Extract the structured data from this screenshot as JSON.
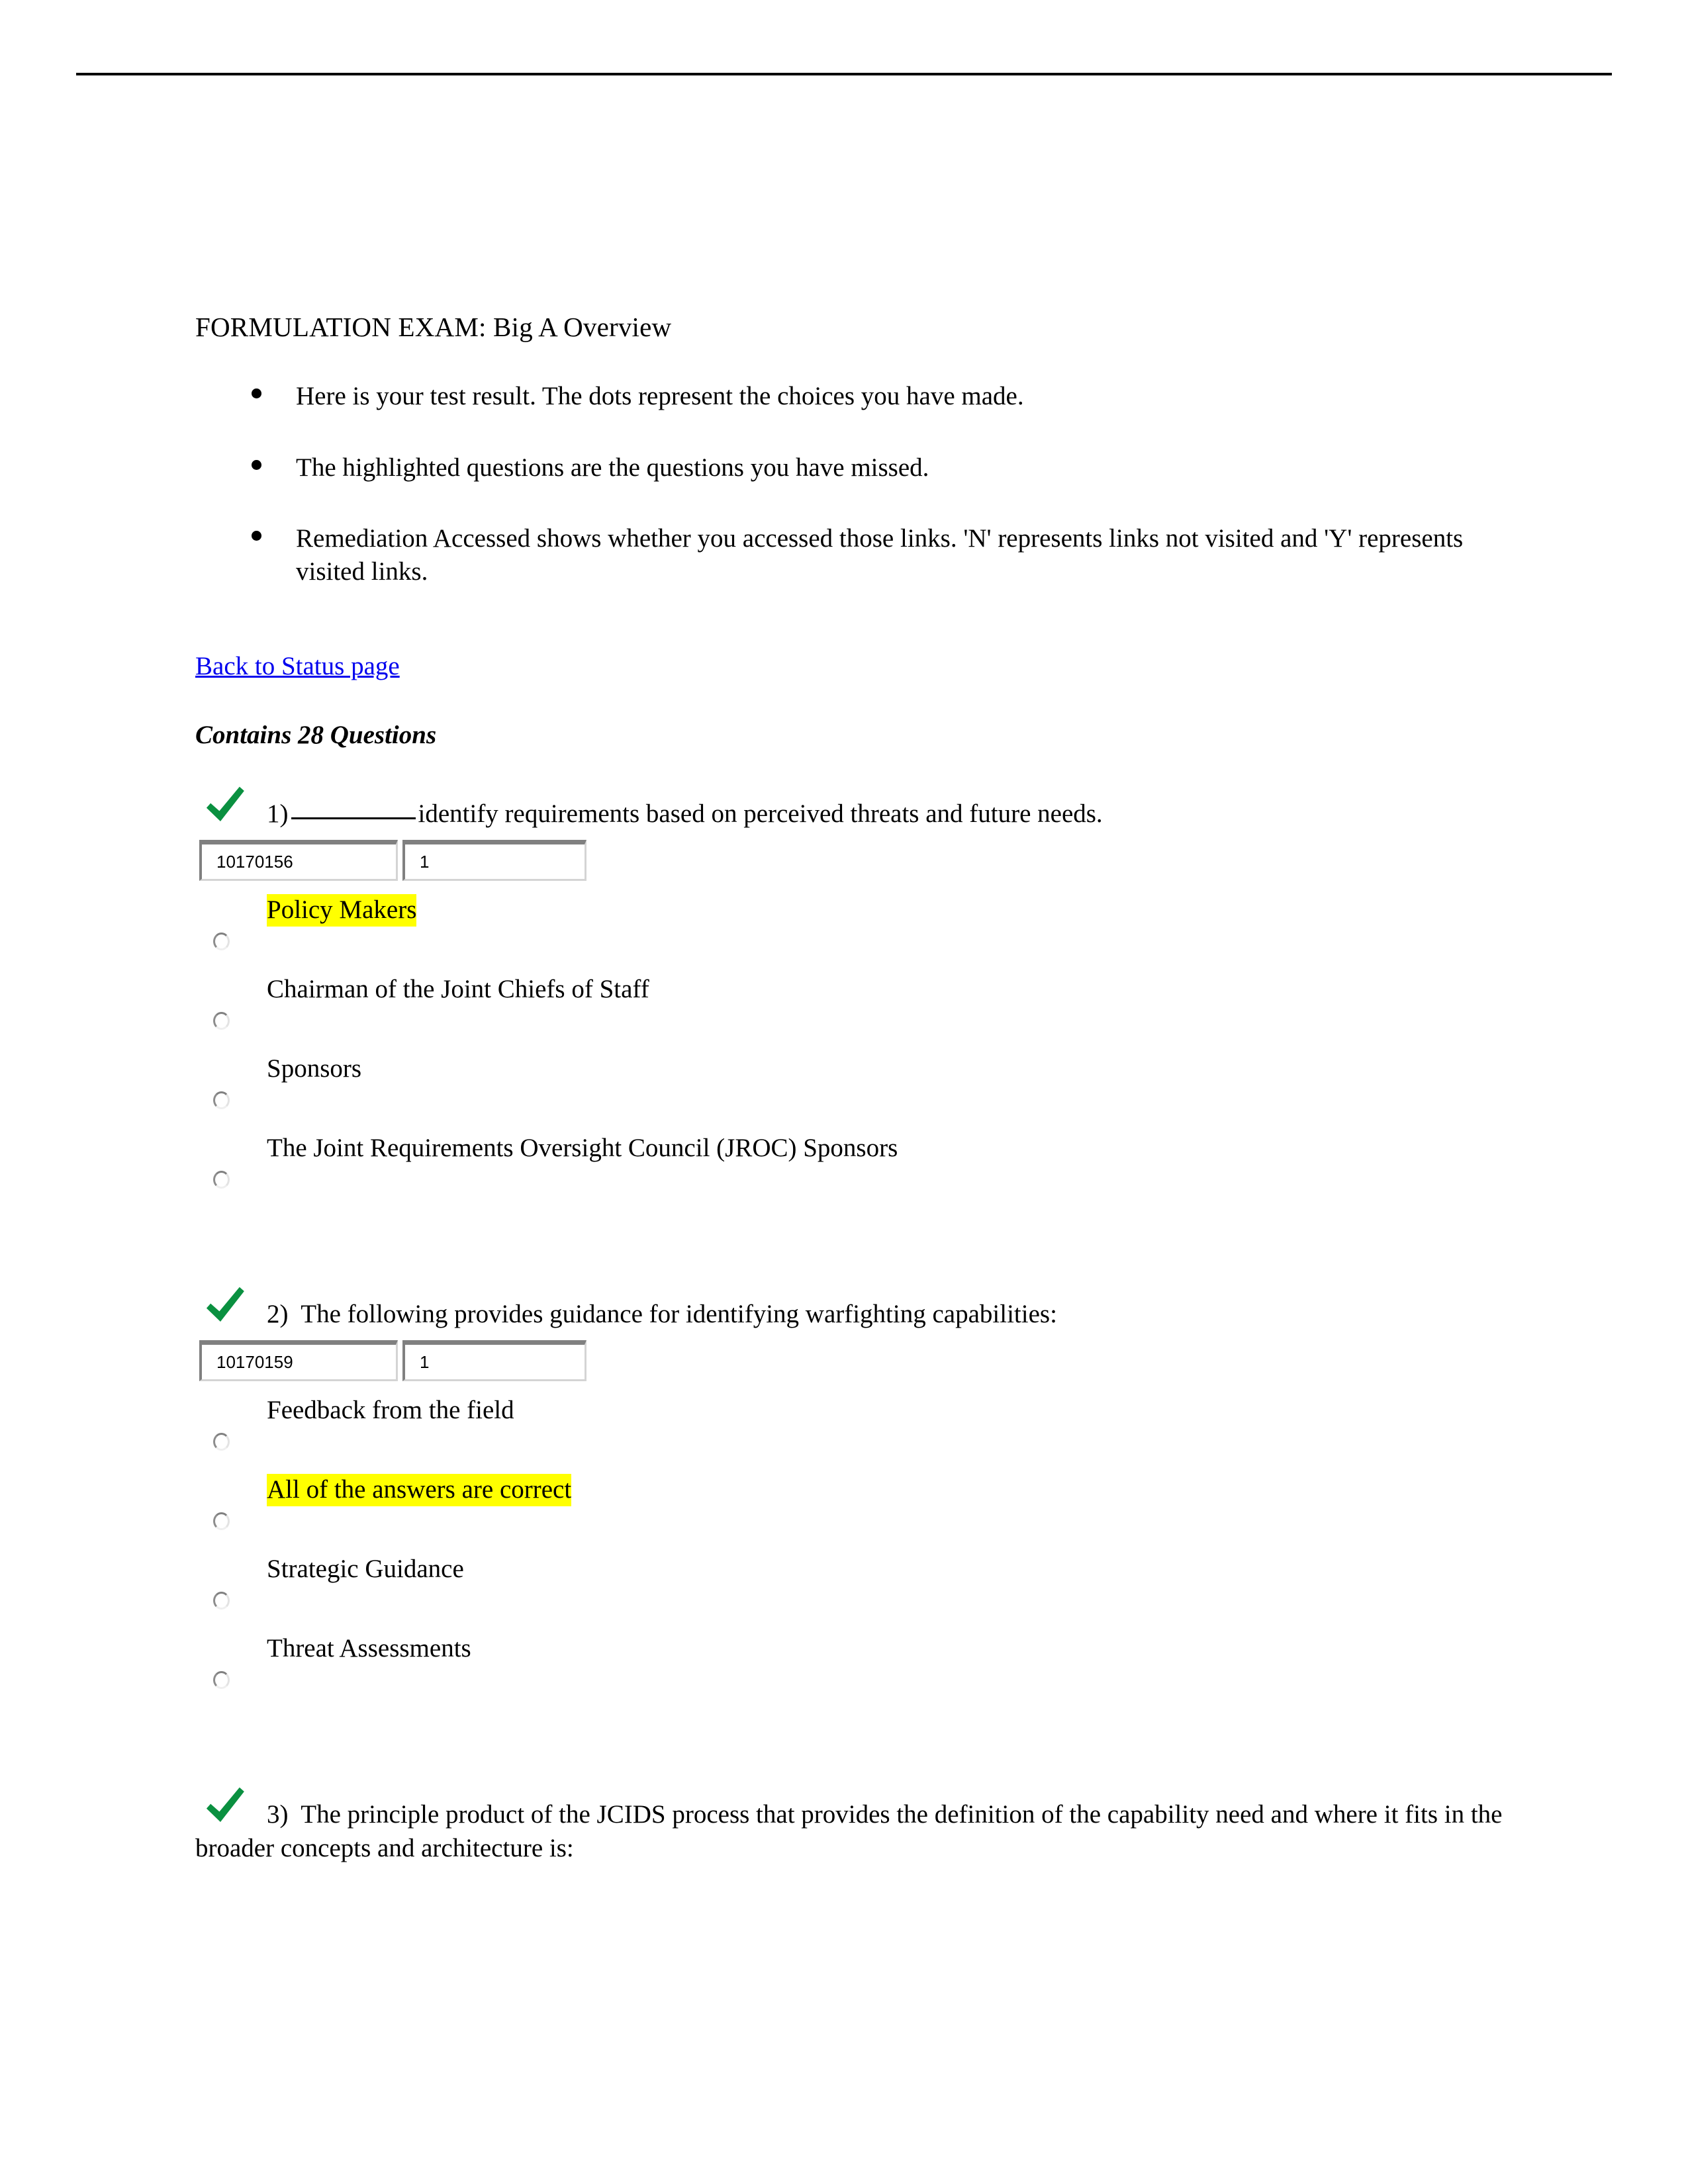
{
  "document": {
    "title": "FORMULATION EXAM: Big A Overview",
    "intro_bullets": [
      "Here is your test result. The dots represent the choices you have made.",
      "The highlighted questions are the questions you have missed.",
      "Remediation Accessed shows whether you accessed those links. 'N' represents links not visited and 'Y' represents visited links."
    ],
    "back_link": "Back to Status page",
    "contains": "Contains 28 Questions"
  },
  "colors": {
    "link": "#0000ee",
    "highlight": "#ffff00",
    "checkmark": "#0a9040",
    "rule": "#000000"
  },
  "icons": {
    "correct": "check-mark"
  },
  "questions": [
    {
      "number": "1)",
      "text_before_blank": "",
      "text_after_blank": "identify requirements based on perceived threats and future needs.",
      "has_blank": true,
      "id_code": "10170156",
      "attempt_count": "1",
      "options": [
        {
          "label": "Policy Makers",
          "highlighted": true
        },
        {
          "label": "Chairman of the Joint Chiefs of Staff",
          "highlighted": false
        },
        {
          "label": "Sponsors",
          "highlighted": false
        },
        {
          "label": "The Joint Requirements Oversight Council (JROC) Sponsors",
          "highlighted": false
        }
      ]
    },
    {
      "number": "2)",
      "text_before_blank": "The following provides guidance for identifying warfighting capabilities:",
      "text_after_blank": "",
      "has_blank": false,
      "id_code": "10170159",
      "attempt_count": "1",
      "options": [
        {
          "label": "Feedback from the field",
          "highlighted": false
        },
        {
          "label": "All of the answers are correct",
          "highlighted": true
        },
        {
          "label": "Strategic Guidance",
          "highlighted": false
        },
        {
          "label": "Threat Assessments",
          "highlighted": false
        }
      ]
    },
    {
      "number": "3)",
      "text_before_blank": "The principle product of the JCIDS process that provides the definition of the capability need and where it fits in the broader concepts and architecture is:",
      "text_after_blank": "",
      "has_blank": false,
      "id_code": "",
      "attempt_count": "",
      "options": []
    }
  ]
}
